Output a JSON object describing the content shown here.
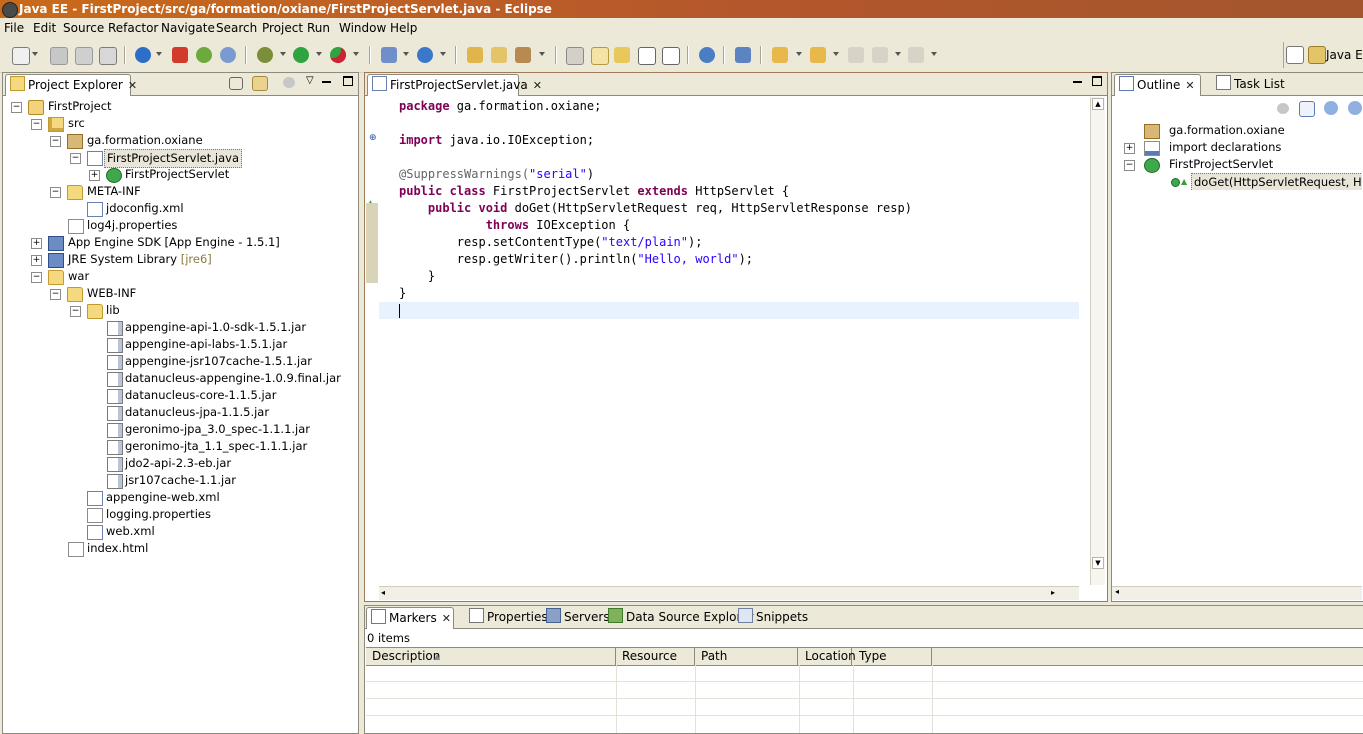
{
  "window": {
    "title": "Java EE - FirstProject/src/ga/formation/oxiane/FirstProjectServlet.java - Eclipse"
  },
  "menu": [
    "File",
    "Edit",
    "Source",
    "Refactor",
    "Navigate",
    "Search",
    "Project",
    "Run",
    "Window",
    "Help"
  ],
  "perspective": {
    "label": "Java EE"
  },
  "explorer": {
    "tab": "Project Explorer",
    "tree": [
      {
        "label": "FirstProject",
        "icon": "project-icon"
      },
      {
        "label": "src",
        "icon": "source-folder-icon"
      },
      {
        "label": "ga.formation.oxiane",
        "icon": "package-icon"
      },
      {
        "label": "FirstProjectServlet.java",
        "icon": "java-file-icon"
      },
      {
        "label": "FirstProjectServlet",
        "icon": "class-icon"
      },
      {
        "label": "META-INF",
        "icon": "folder-icon"
      },
      {
        "label": "jdoconfig.xml",
        "icon": "xml-file-icon"
      },
      {
        "label": "log4j.properties",
        "icon": "file-icon"
      },
      {
        "label": "App Engine SDK [App Engine - 1.5.1]",
        "icon": "library-icon"
      },
      {
        "label": "JRE System Library",
        "suffix": "[jre6]",
        "icon": "library-icon"
      },
      {
        "label": "war",
        "icon": "folder-icon"
      },
      {
        "label": "WEB-INF",
        "icon": "folder-icon"
      },
      {
        "label": "lib",
        "icon": "folder-icon"
      },
      {
        "label": "appengine-api-1.0-sdk-1.5.1.jar",
        "icon": "jar-icon"
      },
      {
        "label": "appengine-api-labs-1.5.1.jar",
        "icon": "jar-icon"
      },
      {
        "label": "appengine-jsr107cache-1.5.1.jar",
        "icon": "jar-icon"
      },
      {
        "label": "datanucleus-appengine-1.0.9.final.jar",
        "icon": "jar-icon"
      },
      {
        "label": "datanucleus-core-1.1.5.jar",
        "icon": "jar-icon"
      },
      {
        "label": "datanucleus-jpa-1.1.5.jar",
        "icon": "jar-icon"
      },
      {
        "label": "geronimo-jpa_3.0_spec-1.1.1.jar",
        "icon": "jar-icon"
      },
      {
        "label": "geronimo-jta_1.1_spec-1.1.1.jar",
        "icon": "jar-icon"
      },
      {
        "label": "jdo2-api-2.3-eb.jar",
        "icon": "jar-icon"
      },
      {
        "label": "jsr107cache-1.1.jar",
        "icon": "jar-icon"
      },
      {
        "label": "appengine-web.xml",
        "icon": "xml-file-icon"
      },
      {
        "label": "logging.properties",
        "icon": "file-icon"
      },
      {
        "label": "web.xml",
        "icon": "xml-file-icon"
      },
      {
        "label": "index.html",
        "icon": "html-file-icon"
      }
    ]
  },
  "editor": {
    "tab": "FirstProjectServlet.java",
    "code": {
      "l1_kw": "package",
      "l1_rest": " ga.formation.oxiane;",
      "l2_kw": "import",
      "l2_rest": " java.io.IOException;",
      "l3_ann": "@SuppressWarnings(",
      "l3_str": "\"serial\"",
      "l3_end": ")",
      "l4_kw1": "public class",
      "l4_mid": " FirstProjectServlet ",
      "l4_kw2": "extends",
      "l4_rest": " HttpServlet {",
      "l5_kw": "    public void",
      "l5_rest": " doGet(HttpServletRequest req, HttpServletResponse resp)",
      "l6_kw": "            throws",
      "l6_rest": " IOException {",
      "l7_a": "        resp.setContentType(",
      "l7_str": "\"text/plain\"",
      "l7_b": ");",
      "l8_a": "        resp.getWriter().println(",
      "l8_str": "\"Hello, world\"",
      "l8_b": ");",
      "l9": "    }",
      "l10": "}"
    }
  },
  "outline": {
    "tabs": [
      "Outline",
      "Task List"
    ],
    "items": [
      {
        "label": "ga.formation.oxiane"
      },
      {
        "label": "import declarations"
      },
      {
        "label": "FirstProjectServlet"
      },
      {
        "label": "doGet(HttpServletRequest, HttpServletResponse)"
      }
    ]
  },
  "bottom": {
    "tabs": [
      "Markers",
      "Properties",
      "Servers",
      "Data Source Explorer",
      "Snippets"
    ],
    "status": "0 items",
    "columns": [
      "Description",
      "Resource",
      "Path",
      "Location",
      "Type"
    ]
  },
  "colors": {
    "titlebar": "#c96a1a",
    "keyword": "#7f0055",
    "string": "#2a00ff",
    "annotation": "#646464"
  }
}
